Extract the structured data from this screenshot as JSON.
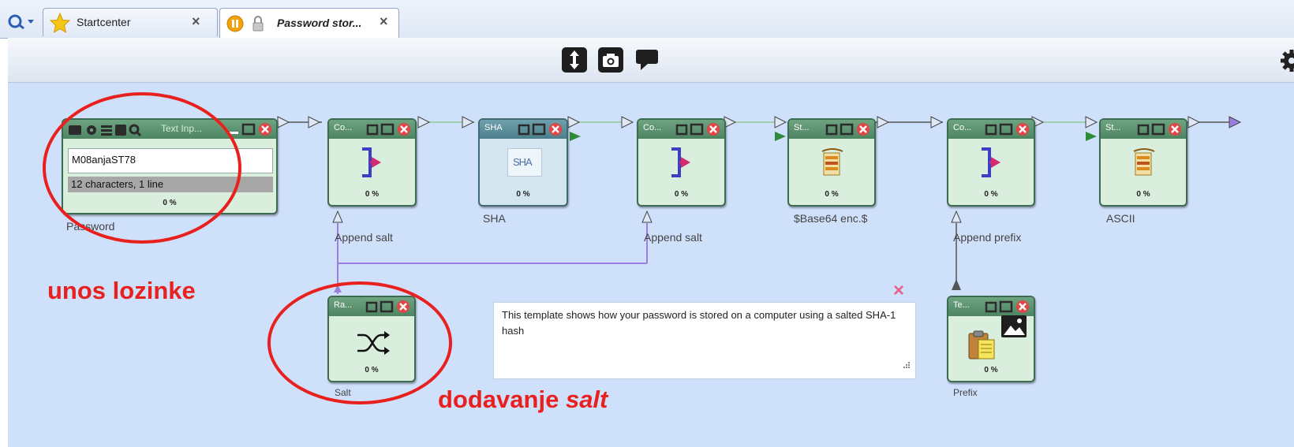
{
  "tabs": [
    {
      "label": "Startcenter",
      "close": "×",
      "active": false
    },
    {
      "label": "Password stor...",
      "close": "×",
      "active": true
    }
  ],
  "toolbar": {
    "buttons": [
      "fit-icon",
      "camera-icon",
      "comment-icon"
    ],
    "settings": "gear-icon"
  },
  "password_input": {
    "header_label": "Text  Inp...",
    "value": "M08anjaST78",
    "status": "12 characters,  1 line",
    "progress": "0 %",
    "caption": "Password"
  },
  "nodes": [
    {
      "title": "Co...",
      "progress": "0 %",
      "caption": "Append salt",
      "icon": "concatenate-icon"
    },
    {
      "title": "SHA",
      "progress": "0 %",
      "caption": "SHA",
      "icon": "sha-icon",
      "icon_text": "SHA"
    },
    {
      "title": "Co...",
      "progress": "0 %",
      "caption": "Append salt",
      "icon": "concatenate-icon"
    },
    {
      "title": "St...",
      "progress": "0 %",
      "caption": "$Base64 enc.$",
      "icon": "string-encoder-icon"
    },
    {
      "title": "Co...",
      "progress": "0 %",
      "caption": "Append prefix",
      "icon": "concatenate-icon"
    },
    {
      "title": "St...",
      "progress": "0 %",
      "caption": "ASCII",
      "icon": "string-encoder-icon"
    },
    {
      "title": "Ra...",
      "progress": "0 %",
      "caption": "Salt",
      "icon": "shuffle-icon"
    },
    {
      "title": "Te...",
      "progress": "0 %",
      "caption": "Prefix",
      "icon": "clipboard-icon"
    }
  ],
  "note": {
    "text": "This template shows how your password is stored on a computer using a salted SHA-1 hash",
    "close": "×"
  },
  "annotations": {
    "password_label": "unos lozinke",
    "salt_label_prefix": "dodavanje",
    "salt_label_emphasis": "salt"
  },
  "colors": {
    "annotation": "#e8201e",
    "canvas": "#cfe0fb",
    "node_fill": "#d9eedd",
    "node_header": "#5a9170",
    "connector": "#9b7ee0"
  }
}
